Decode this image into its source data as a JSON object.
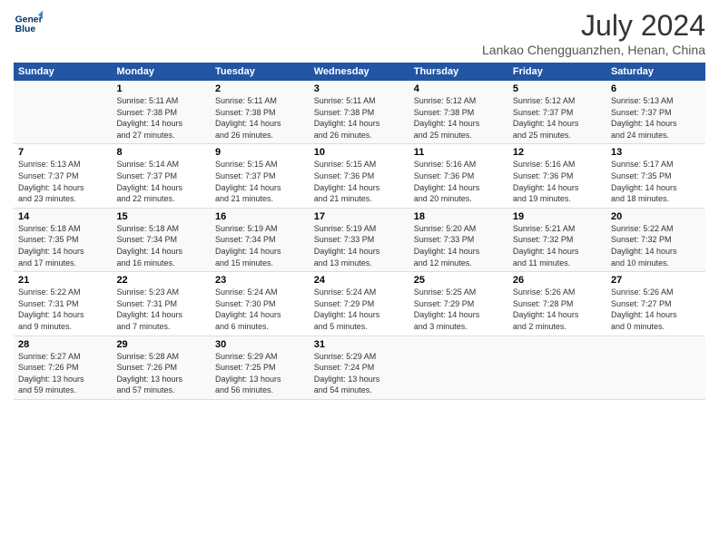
{
  "logo": {
    "line1": "General",
    "line2": "Blue"
  },
  "title": "July 2024",
  "subtitle": "Lankao Chengguanzhen, Henan, China",
  "days_header": [
    "Sunday",
    "Monday",
    "Tuesday",
    "Wednesday",
    "Thursday",
    "Friday",
    "Saturday"
  ],
  "weeks": [
    [
      {
        "num": "",
        "detail": ""
      },
      {
        "num": "1",
        "detail": "Sunrise: 5:11 AM\nSunset: 7:38 PM\nDaylight: 14 hours\nand 27 minutes."
      },
      {
        "num": "2",
        "detail": "Sunrise: 5:11 AM\nSunset: 7:38 PM\nDaylight: 14 hours\nand 26 minutes."
      },
      {
        "num": "3",
        "detail": "Sunrise: 5:11 AM\nSunset: 7:38 PM\nDaylight: 14 hours\nand 26 minutes."
      },
      {
        "num": "4",
        "detail": "Sunrise: 5:12 AM\nSunset: 7:38 PM\nDaylight: 14 hours\nand 25 minutes."
      },
      {
        "num": "5",
        "detail": "Sunrise: 5:12 AM\nSunset: 7:37 PM\nDaylight: 14 hours\nand 25 minutes."
      },
      {
        "num": "6",
        "detail": "Sunrise: 5:13 AM\nSunset: 7:37 PM\nDaylight: 14 hours\nand 24 minutes."
      }
    ],
    [
      {
        "num": "7",
        "detail": "Sunrise: 5:13 AM\nSunset: 7:37 PM\nDaylight: 14 hours\nand 23 minutes."
      },
      {
        "num": "8",
        "detail": "Sunrise: 5:14 AM\nSunset: 7:37 PM\nDaylight: 14 hours\nand 22 minutes."
      },
      {
        "num": "9",
        "detail": "Sunrise: 5:15 AM\nSunset: 7:37 PM\nDaylight: 14 hours\nand 21 minutes."
      },
      {
        "num": "10",
        "detail": "Sunrise: 5:15 AM\nSunset: 7:36 PM\nDaylight: 14 hours\nand 21 minutes."
      },
      {
        "num": "11",
        "detail": "Sunrise: 5:16 AM\nSunset: 7:36 PM\nDaylight: 14 hours\nand 20 minutes."
      },
      {
        "num": "12",
        "detail": "Sunrise: 5:16 AM\nSunset: 7:36 PM\nDaylight: 14 hours\nand 19 minutes."
      },
      {
        "num": "13",
        "detail": "Sunrise: 5:17 AM\nSunset: 7:35 PM\nDaylight: 14 hours\nand 18 minutes."
      }
    ],
    [
      {
        "num": "14",
        "detail": "Sunrise: 5:18 AM\nSunset: 7:35 PM\nDaylight: 14 hours\nand 17 minutes."
      },
      {
        "num": "15",
        "detail": "Sunrise: 5:18 AM\nSunset: 7:34 PM\nDaylight: 14 hours\nand 16 minutes."
      },
      {
        "num": "16",
        "detail": "Sunrise: 5:19 AM\nSunset: 7:34 PM\nDaylight: 14 hours\nand 15 minutes."
      },
      {
        "num": "17",
        "detail": "Sunrise: 5:19 AM\nSunset: 7:33 PM\nDaylight: 14 hours\nand 13 minutes."
      },
      {
        "num": "18",
        "detail": "Sunrise: 5:20 AM\nSunset: 7:33 PM\nDaylight: 14 hours\nand 12 minutes."
      },
      {
        "num": "19",
        "detail": "Sunrise: 5:21 AM\nSunset: 7:32 PM\nDaylight: 14 hours\nand 11 minutes."
      },
      {
        "num": "20",
        "detail": "Sunrise: 5:22 AM\nSunset: 7:32 PM\nDaylight: 14 hours\nand 10 minutes."
      }
    ],
    [
      {
        "num": "21",
        "detail": "Sunrise: 5:22 AM\nSunset: 7:31 PM\nDaylight: 14 hours\nand 9 minutes."
      },
      {
        "num": "22",
        "detail": "Sunrise: 5:23 AM\nSunset: 7:31 PM\nDaylight: 14 hours\nand 7 minutes."
      },
      {
        "num": "23",
        "detail": "Sunrise: 5:24 AM\nSunset: 7:30 PM\nDaylight: 14 hours\nand 6 minutes."
      },
      {
        "num": "24",
        "detail": "Sunrise: 5:24 AM\nSunset: 7:29 PM\nDaylight: 14 hours\nand 5 minutes."
      },
      {
        "num": "25",
        "detail": "Sunrise: 5:25 AM\nSunset: 7:29 PM\nDaylight: 14 hours\nand 3 minutes."
      },
      {
        "num": "26",
        "detail": "Sunrise: 5:26 AM\nSunset: 7:28 PM\nDaylight: 14 hours\nand 2 minutes."
      },
      {
        "num": "27",
        "detail": "Sunrise: 5:26 AM\nSunset: 7:27 PM\nDaylight: 14 hours\nand 0 minutes."
      }
    ],
    [
      {
        "num": "28",
        "detail": "Sunrise: 5:27 AM\nSunset: 7:26 PM\nDaylight: 13 hours\nand 59 minutes."
      },
      {
        "num": "29",
        "detail": "Sunrise: 5:28 AM\nSunset: 7:26 PM\nDaylight: 13 hours\nand 57 minutes."
      },
      {
        "num": "30",
        "detail": "Sunrise: 5:29 AM\nSunset: 7:25 PM\nDaylight: 13 hours\nand 56 minutes."
      },
      {
        "num": "31",
        "detail": "Sunrise: 5:29 AM\nSunset: 7:24 PM\nDaylight: 13 hours\nand 54 minutes."
      },
      {
        "num": "",
        "detail": ""
      },
      {
        "num": "",
        "detail": ""
      },
      {
        "num": "",
        "detail": ""
      }
    ]
  ]
}
